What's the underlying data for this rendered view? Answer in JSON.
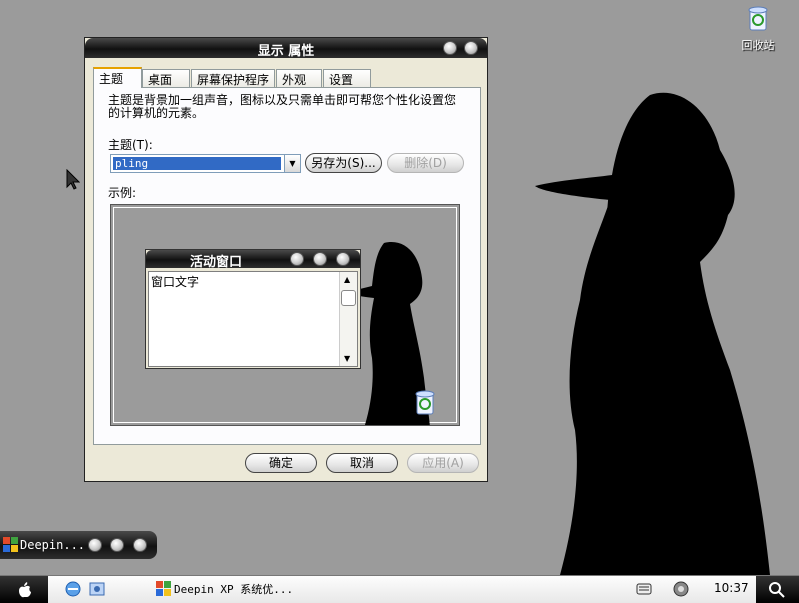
{
  "desktop": {
    "recycle_bin_label": "回收站"
  },
  "dialog": {
    "title": "显示 属性",
    "tabs": [
      "主题",
      "桌面",
      "屏幕保护程序",
      "外观",
      "设置"
    ],
    "description": "主题是背景加一组声音，图标以及只需单击即可帮您个性化设置您的计算机的元素。",
    "theme_label": "主题(T):",
    "theme_value": "pling",
    "save_as_label": "另存为(S)...",
    "delete_label": "删除(D)",
    "sample_label": "示例:",
    "preview": {
      "window_title": "活动窗口",
      "window_text": "窗口文字"
    },
    "ok_label": "确定",
    "cancel_label": "取消",
    "apply_label": "应用(A)"
  },
  "task_pill": {
    "label": "Deepin..."
  },
  "taskbar": {
    "task_label": "Deepin XP 系统优...",
    "clock": "10:37"
  },
  "colors": {
    "desktop_bg": "#9b9b9b",
    "titlebar": "#111111",
    "selection": "#316ac5"
  }
}
